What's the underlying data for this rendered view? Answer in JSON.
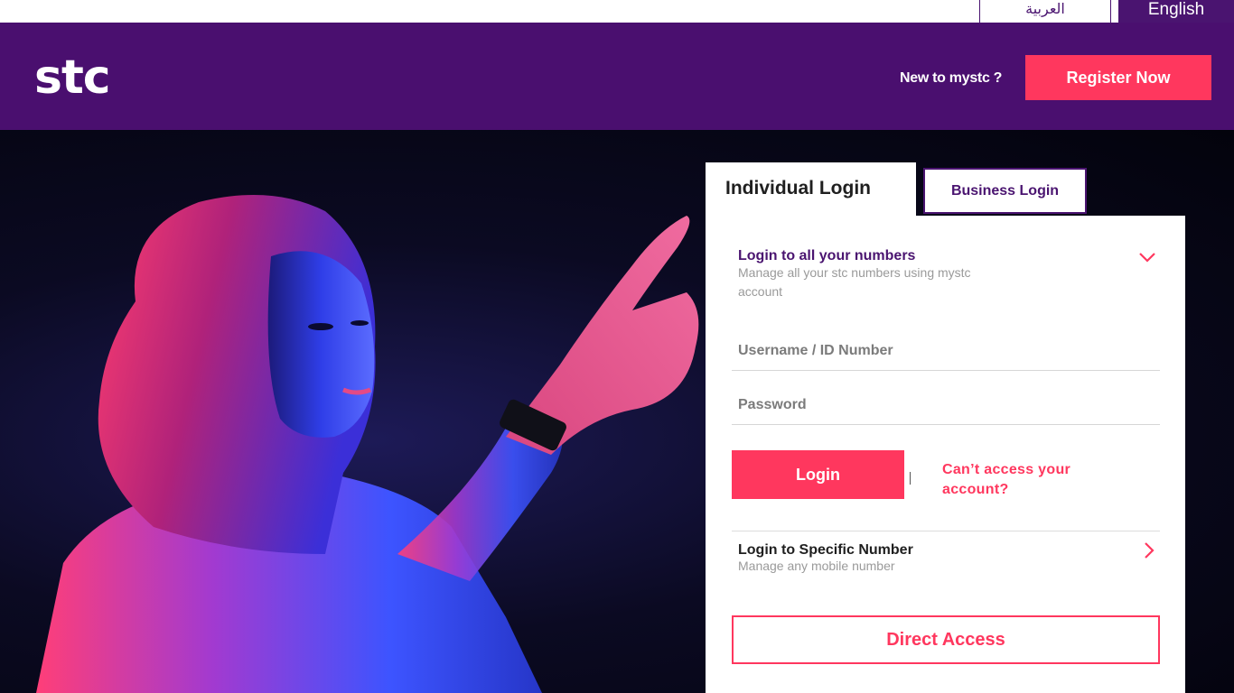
{
  "language": {
    "arabic_label": "العربية",
    "english_label": "English"
  },
  "header": {
    "logo_text": "stc",
    "new_prompt": "New to mystc ?",
    "register_label": "Register Now"
  },
  "tabs": {
    "individual_label": "Individual Login",
    "business_label": "Business Login"
  },
  "login_all": {
    "title": "Login to all your numbers",
    "subtitle": "Manage all your stc numbers using mystc account",
    "username_placeholder": "Username / ID Number",
    "password_placeholder": "Password",
    "login_label": "Login",
    "cant_access_label": "Can’t access your account?"
  },
  "login_specific": {
    "title": "Login to Specific Number",
    "subtitle": "Manage any mobile number"
  },
  "direct_access_label": "Direct Access",
  "colors": {
    "brand_purple": "#4a0f6f",
    "accent_pink": "#ff375e"
  },
  "icons": {
    "expand": "chevron-down-icon",
    "navigate": "chevron-right-icon"
  }
}
